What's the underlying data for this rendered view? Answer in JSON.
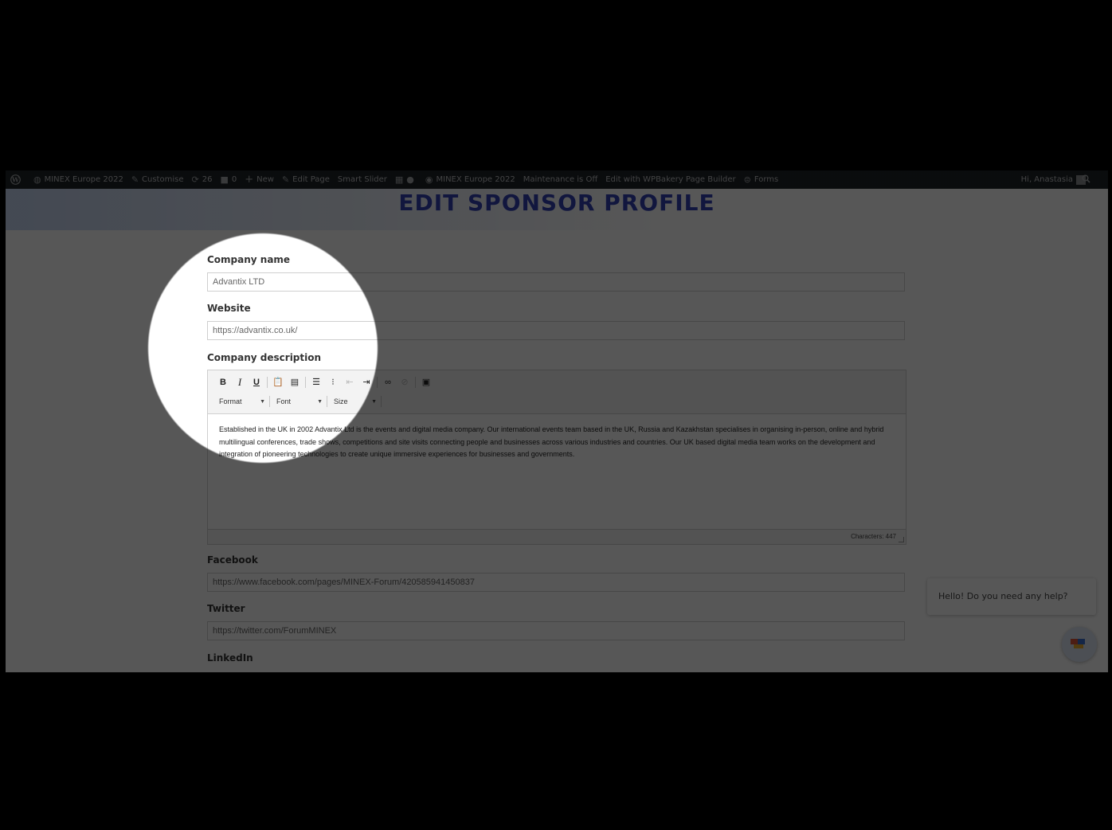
{
  "adminbar": {
    "site_name": "MINEX Europe 2022",
    "customise": "Customise",
    "updates": "26",
    "comments": "0",
    "new": "New",
    "edit_page": "Edit Page",
    "smart_slider": "Smart Slider",
    "site_name_2": "MINEX Europe 2022",
    "maintenance": "Maintenance is Off",
    "wpbakery": "Edit with WPBakery Page Builder",
    "forms": "Forms",
    "greeting": "Hi, Anastasia"
  },
  "page": {
    "title": "EDIT SPONSOR PROFILE"
  },
  "form": {
    "company_name_label": "Company name",
    "company_name_value": "Advantix LTD",
    "website_label": "Website",
    "website_value": "https://advantix.co.uk/",
    "description_label": "Company description",
    "editor": {
      "format": "Format",
      "font": "Font",
      "size": "Size",
      "content": "Established in the UK in 2002 Advantix Ltd is the events and digital media company. Our international events team based in the UK, Russia and Kazakhstan specialises in organising in-person, online and hybrid multilingual conferences, trade shows, competitions and site visits connecting people and businesses across various industries and countries. Our UK based digital media team works on the development and integration of pioneering technologies to create unique immersive experiences for businesses and governments.",
      "char_count": "Characters: 447"
    },
    "facebook_label": "Facebook",
    "facebook_value": "https://www.facebook.com/pages/MINEX-Forum/420585941450837",
    "twitter_label": "Twitter",
    "twitter_value": "https://twitter.com/ForumMINEX",
    "linkedin_label": "LinkedIn"
  },
  "chat": {
    "message": "Hello! Do you need any help?"
  }
}
